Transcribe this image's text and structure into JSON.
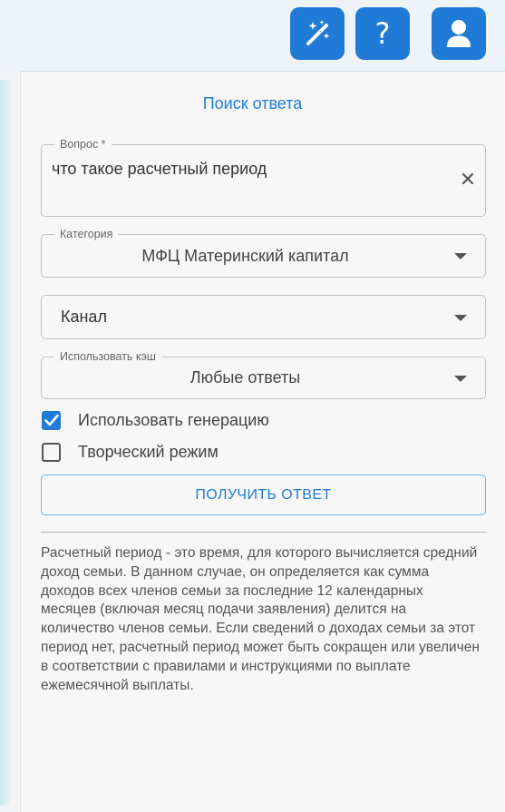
{
  "toolbar": {
    "magic_icon": "magic-wand-icon",
    "help_label": "?",
    "user_icon": "user-icon",
    "accent": "#1f7bd6"
  },
  "panel": {
    "title": "Поиск ответа"
  },
  "form": {
    "question": {
      "legend": "Вопрос *",
      "value": "что такое расчетный период"
    },
    "category": {
      "legend": "Категория",
      "value": "МФЦ Материнский капитал"
    },
    "channel": {
      "value": "Канал"
    },
    "cache": {
      "legend": "Использовать кэш",
      "value": "Любые ответы"
    },
    "use_generation": {
      "label": "Использовать генерацию",
      "checked": true
    },
    "creative_mode": {
      "label": "Творческий режим",
      "checked": false
    },
    "submit_label": "ПОЛУЧИТЬ ОТВЕТ"
  },
  "answer": {
    "text": "Расчетный период - это время, для которого вычисляется средний доход семьи. В данном случае, он определяется как сумма доходов всех членов семьи за последние 12 календарных месяцев (включая месяц подачи заявления) делится на количество членов семьи. Если сведений о доходах семьи за этот период нет, расчетный период может быть сокращен или увеличен в соответствии с правилами и инструкциями по выплате ежемесячной выплаты."
  }
}
